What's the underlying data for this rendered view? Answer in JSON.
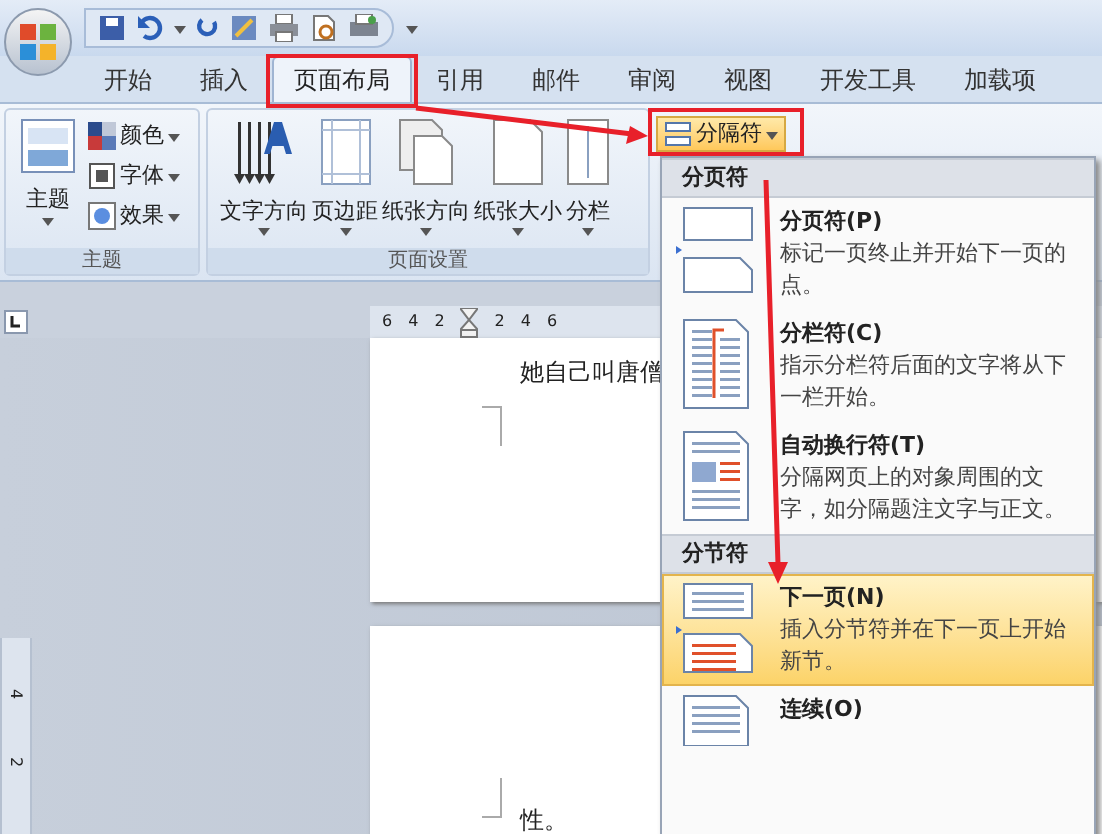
{
  "tabs": [
    {
      "label": "开始",
      "selected": false
    },
    {
      "label": "插入",
      "selected": false
    },
    {
      "label": "页面布局",
      "selected": true
    },
    {
      "label": "引用",
      "selected": false
    },
    {
      "label": "邮件",
      "selected": false
    },
    {
      "label": "审阅",
      "selected": false
    },
    {
      "label": "视图",
      "selected": false
    },
    {
      "label": "开发工具",
      "selected": false
    },
    {
      "label": "加载项",
      "selected": false
    }
  ],
  "theme_group": {
    "label": "主题",
    "theme_button": "主题",
    "options": [
      "颜色",
      "字体",
      "效果"
    ]
  },
  "page_setup_group": {
    "label": "页面设置",
    "buttons": [
      "文字方向",
      "页边距",
      "纸张方向",
      "纸张大小",
      "分栏"
    ],
    "breaks_button": "分隔符"
  },
  "ruler": {
    "ticks": [
      "6",
      "4",
      "2",
      "2",
      "4",
      "6"
    ],
    "vertical_ticks": [
      "4",
      "2"
    ]
  },
  "document": {
    "pages": [
      {
        "text": "她自己叫唐僧"
      },
      {
        "text": "性。"
      }
    ]
  },
  "breaks_menu": {
    "sections": [
      {
        "title": "分页符",
        "items": [
          {
            "kind": "page-break",
            "title": "分页符(P)",
            "description": "标记一页终止并开始下一页的点。",
            "selected": false
          },
          {
            "kind": "column-break",
            "title": "分栏符(C)",
            "description": "指示分栏符后面的文字将从下一栏开始。",
            "selected": false
          },
          {
            "kind": "text-wrap",
            "title": "自动换行符(T)",
            "description": "分隔网页上的对象周围的文字，如分隔题注文字与正文。",
            "selected": false
          }
        ]
      },
      {
        "title": "分节符",
        "items": [
          {
            "kind": "next-page",
            "title": "下一页(N)",
            "description": "插入分节符并在下一页上开始新节。",
            "selected": true
          },
          {
            "kind": "continuous",
            "title": "连续(O)",
            "selected": false
          }
        ]
      }
    ]
  }
}
